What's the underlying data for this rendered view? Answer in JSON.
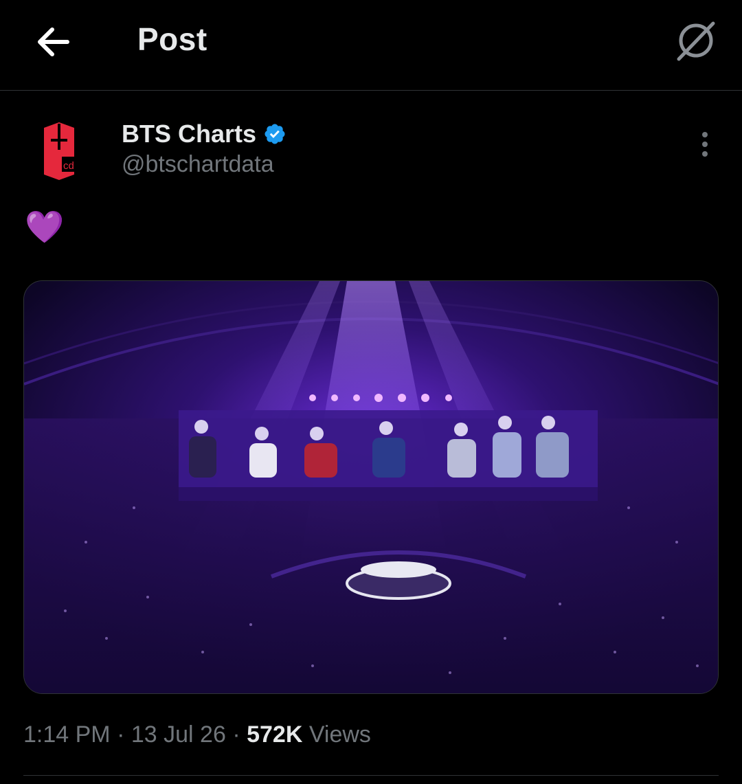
{
  "header": {
    "title": "Post",
    "back_icon": "arrow-left-icon",
    "grok_icon": "grok-icon"
  },
  "author": {
    "display_name": "BTS Charts",
    "handle": "@btschartdata",
    "verified": true,
    "verified_color": "#1d9bf0",
    "avatar_color": "#e5283c",
    "avatar_text": "cd"
  },
  "post": {
    "text": "💜",
    "media_alt": "Concert stadium photo with purple lights and big screens showing seven performers"
  },
  "meta": {
    "time": "1:14 PM",
    "date": "13 Jul 26",
    "views_count": "572K",
    "views_label": "Views",
    "separator": "·"
  },
  "colors": {
    "background": "#000000",
    "text_primary": "#e7e9ea",
    "text_secondary": "#71767b",
    "border": "#2f3336"
  }
}
